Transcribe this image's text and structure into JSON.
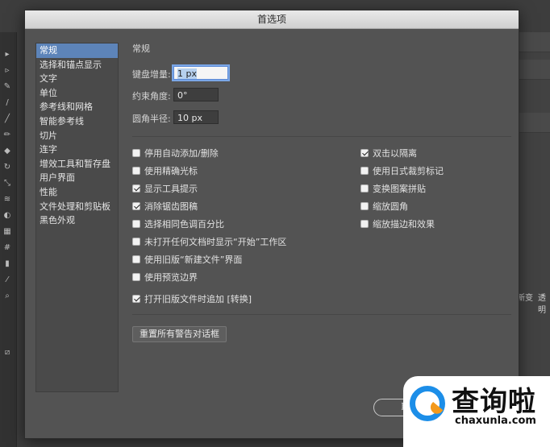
{
  "dialog": {
    "title": "首选项",
    "sidebar": [
      {
        "label": "常规",
        "active": true
      },
      {
        "label": "选择和锚点显示"
      },
      {
        "label": "文字"
      },
      {
        "label": "单位"
      },
      {
        "label": "参考线和网格"
      },
      {
        "label": "智能参考线"
      },
      {
        "label": "切片"
      },
      {
        "label": "连字"
      },
      {
        "label": "增效工具和暂存盘"
      },
      {
        "label": "用户界面"
      },
      {
        "label": "性能"
      },
      {
        "label": "文件处理和剪贴板"
      },
      {
        "label": "黑色外观"
      }
    ],
    "section_title": "常规",
    "fields": {
      "keyboard_increment": {
        "label": "键盘增量:",
        "value": "1 px"
      },
      "constrain_angle": {
        "label": "约束角度:",
        "value": "0°"
      },
      "corner_radius": {
        "label": "圆角半径:",
        "value": "10 px"
      }
    },
    "checkboxes_left": [
      {
        "label": "停用自动添加/删除",
        "checked": false
      },
      {
        "label": "使用精确光标",
        "checked": false
      },
      {
        "label": "显示工具提示",
        "checked": true
      },
      {
        "label": "消除锯齿图稿",
        "checked": true
      },
      {
        "label": "选择相同色调百分比",
        "checked": false
      },
      {
        "label": "未打开任何文档时显示“开始”工作区",
        "checked": false
      },
      {
        "label": "使用旧版“新建文件”界面",
        "checked": false
      },
      {
        "label": "使用预览边界",
        "checked": false
      }
    ],
    "checkboxes_right": [
      {
        "label": "双击以隔离",
        "checked": true
      },
      {
        "label": "使用日式裁剪标记",
        "checked": false
      },
      {
        "label": "变换图案拼贴",
        "checked": false
      },
      {
        "label": "缩放圆角",
        "checked": false
      },
      {
        "label": "缩放描边和效果",
        "checked": false
      }
    ],
    "checkbox_legacy": {
      "label": "打开旧版文件时追加 [转换]",
      "checked": true
    },
    "reset_button": "重置所有警告对话框",
    "ok_button": "取"
  },
  "background": {
    "tab1": "新变",
    "tab2": "透明"
  },
  "watermark": {
    "cn": "查询啦",
    "en": "chaxunla.com"
  },
  "colors": {
    "dialog_bg": "#535353",
    "selection": "#5d84b9",
    "logo_blue": "#1c8ee8",
    "logo_orange": "#f39a1d"
  }
}
